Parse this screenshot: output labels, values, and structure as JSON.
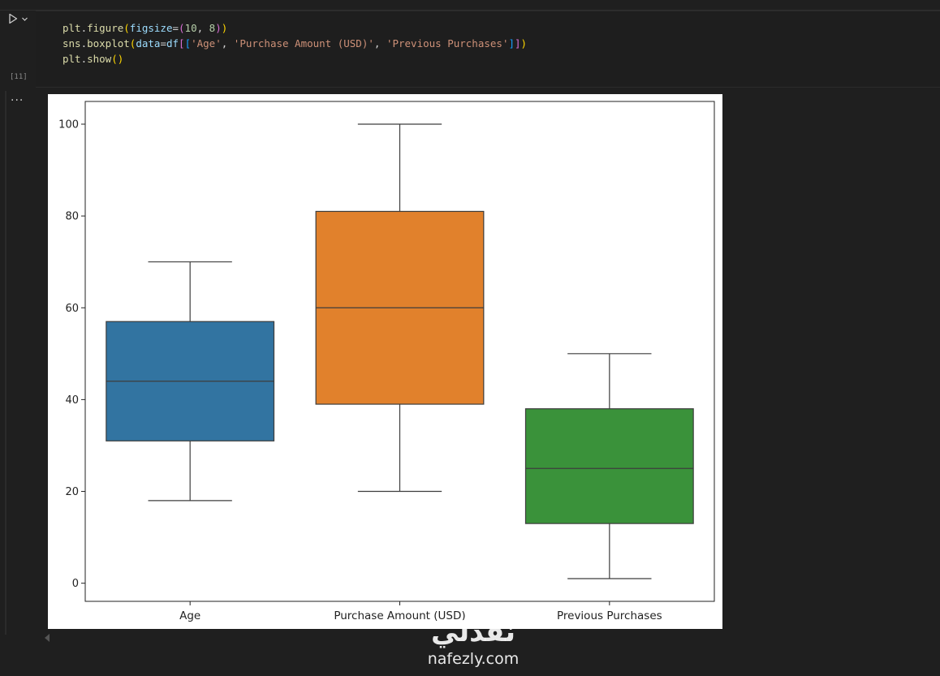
{
  "cell": {
    "execution_count": "[11]",
    "code_lines": [
      [
        [
          "fn",
          "plt"
        ],
        [
          "op",
          "."
        ],
        [
          "fn",
          "figure"
        ],
        [
          "p1",
          "("
        ],
        [
          "var",
          "figsize"
        ],
        [
          "op",
          "="
        ],
        [
          "p2",
          "("
        ],
        [
          "num",
          "10"
        ],
        [
          "op",
          ", "
        ],
        [
          "num",
          "8"
        ],
        [
          "p2",
          ")"
        ],
        [
          "p1",
          ")"
        ]
      ],
      [
        [
          "fn",
          "sns"
        ],
        [
          "op",
          "."
        ],
        [
          "fn",
          "boxplot"
        ],
        [
          "p1",
          "("
        ],
        [
          "var",
          "data"
        ],
        [
          "op",
          "="
        ],
        [
          "var",
          "df"
        ],
        [
          "p2",
          "["
        ],
        [
          "p3",
          "["
        ],
        [
          "str",
          "'Age'"
        ],
        [
          "op",
          ", "
        ],
        [
          "str",
          "'Purchase Amount (USD)'"
        ],
        [
          "op",
          ", "
        ],
        [
          "str",
          "'Previous Purchases'"
        ],
        [
          "p3",
          "]"
        ],
        [
          "p2",
          "]"
        ],
        [
          "p1",
          ")"
        ]
      ],
      [
        [
          "fn",
          "plt"
        ],
        [
          "op",
          "."
        ],
        [
          "fn",
          "show"
        ],
        [
          "p1",
          "()"
        ]
      ]
    ]
  },
  "output": {
    "more_label": "..."
  },
  "chart_data": {
    "type": "box",
    "categories": [
      "Age",
      "Purchase Amount (USD)",
      "Previous Purchases"
    ],
    "boxes": [
      {
        "name": "Age",
        "whisker_low": 18,
        "q1": 31,
        "median": 44,
        "q3": 57,
        "whisker_high": 70,
        "color": "#3274a1"
      },
      {
        "name": "Purchase Amount (USD)",
        "whisker_low": 20,
        "q1": 39,
        "median": 60,
        "q3": 81,
        "whisker_high": 100,
        "color": "#e1812c"
      },
      {
        "name": "Previous Purchases",
        "whisker_low": 1,
        "q1": 13,
        "median": 25,
        "q3": 38,
        "whisker_high": 50,
        "color": "#3a923a"
      }
    ],
    "y_ticks": [
      0,
      20,
      40,
      60,
      80,
      100
    ],
    "ylim": [
      -3.95,
      104.95
    ],
    "xlabel": "",
    "ylabel": "",
    "grid": false
  },
  "watermark": {
    "arabic": "نفذلي",
    "latin": "nafezly.com"
  }
}
